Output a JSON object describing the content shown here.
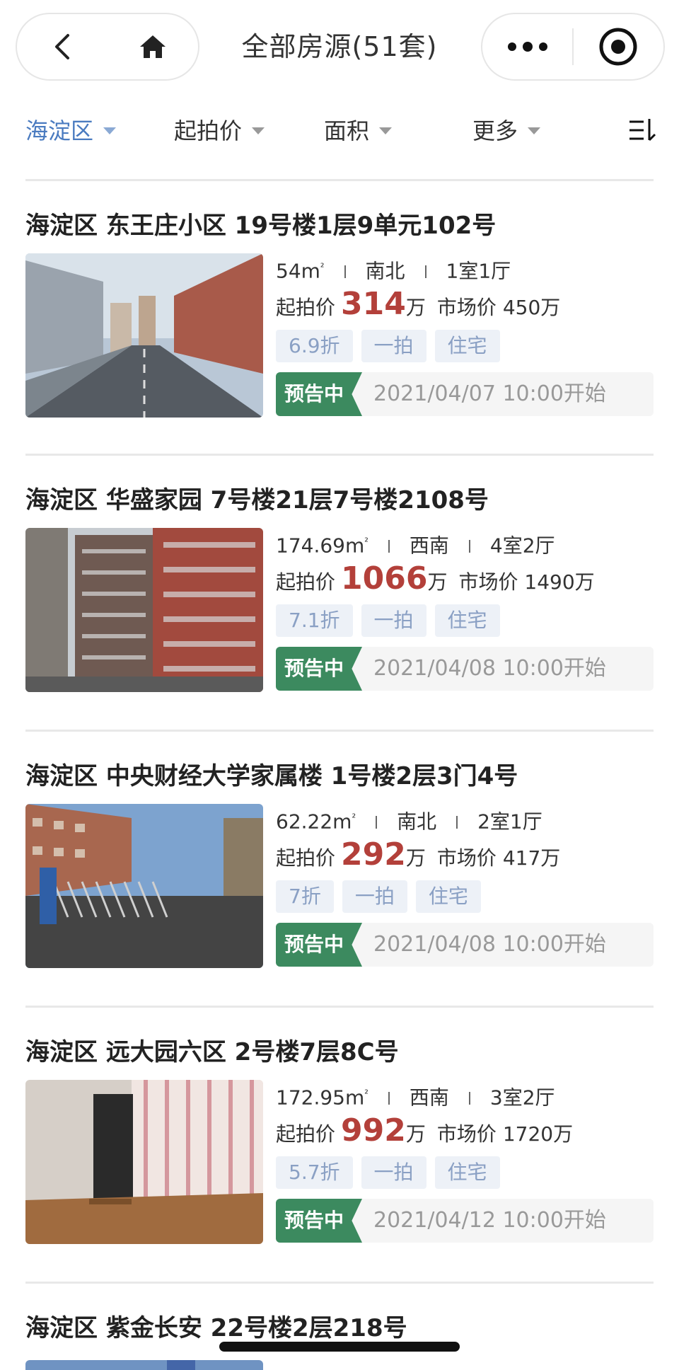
{
  "header": {
    "title": "全部房源(51套)",
    "back_icon": "chevron-left-icon",
    "home_icon": "home-icon",
    "more_icon": "more-dots-icon",
    "target_icon": "target-icon"
  },
  "filters": [
    {
      "label": "海淀区",
      "active": true
    },
    {
      "label": "起拍价",
      "active": false
    },
    {
      "label": "面积",
      "active": false
    },
    {
      "label": "更多",
      "active": false
    }
  ],
  "filter_menu_icon": "sort-list-icon",
  "listings": [
    {
      "title": "海淀区 东王庄小区 19号楼1层9单元102号",
      "area": "54m",
      "area_sup": "²",
      "orientation": "南北",
      "layout": "1室1厅",
      "start_label": "起拍价",
      "start_price": "314",
      "start_unit": "万",
      "market_label": "市场价",
      "market_price": "450万",
      "tags": [
        "6.9折",
        "一拍",
        "住宅"
      ],
      "status": "预告中",
      "start_time": "2021/04/07 10:00开始"
    },
    {
      "title": "海淀区 华盛家园 7号楼21层7号楼2108号",
      "area": "174.69m",
      "area_sup": "²",
      "orientation": "西南",
      "layout": "4室2厅",
      "start_label": "起拍价",
      "start_price": "1066",
      "start_unit": "万",
      "market_label": "市场价",
      "market_price": "1490万",
      "tags": [
        "7.1折",
        "一拍",
        "住宅"
      ],
      "status": "预告中",
      "start_time": "2021/04/08 10:00开始"
    },
    {
      "title": "海淀区 中央财经大学家属楼 1号楼2层3门4号",
      "area": "62.22m",
      "area_sup": "²",
      "orientation": "南北",
      "layout": "2室1厅",
      "start_label": "起拍价",
      "start_price": "292",
      "start_unit": "万",
      "market_label": "市场价",
      "market_price": "417万",
      "tags": [
        "7折",
        "一拍",
        "住宅"
      ],
      "status": "预告中",
      "start_time": "2021/04/08 10:00开始"
    },
    {
      "title": "海淀区 远大园六区 2号楼7层8C号",
      "area": "172.95m",
      "area_sup": "²",
      "orientation": "西南",
      "layout": "3室2厅",
      "start_label": "起拍价",
      "start_price": "992",
      "start_unit": "万",
      "market_label": "市场价",
      "market_price": "1720万",
      "tags": [
        "5.7折",
        "一拍",
        "住宅"
      ],
      "status": "预告中",
      "start_time": "2021/04/12 10:00开始"
    },
    {
      "title": "海淀区 紫金长安 22号楼2层218号"
    }
  ],
  "colors": {
    "accent_blue": "#4a7bc0",
    "price_red": "#b3403a",
    "status_green": "#3c8a5f",
    "tag_bg": "#edf1f7"
  }
}
